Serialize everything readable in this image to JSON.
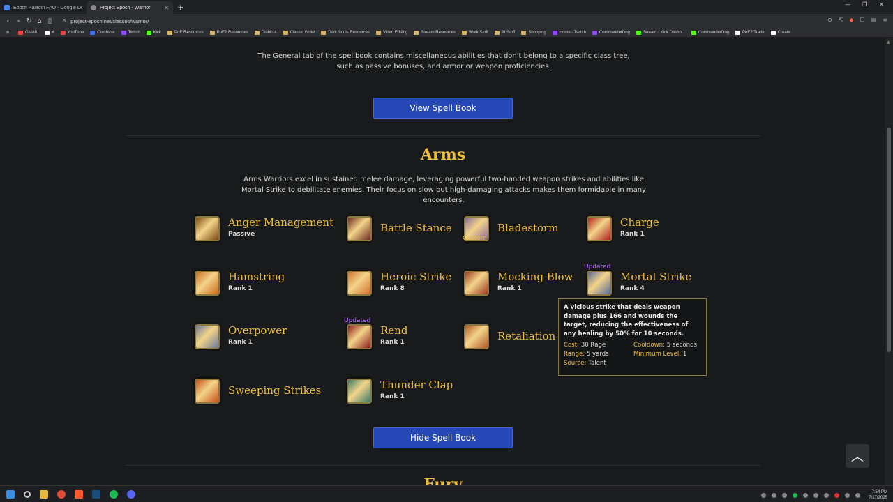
{
  "browser": {
    "tabs": [
      {
        "title": "Epoch Paladin FAQ - Google Docs",
        "active": false,
        "favicon_color": "#4285f4"
      },
      {
        "title": "Project Epoch - Warrior",
        "active": true,
        "favicon_color": "#8a8a8a"
      }
    ],
    "new_tab_icon": "plus-icon",
    "url": "project-epoch.net/classes/warrior/",
    "bookmarks": [
      {
        "label": "GMAIL",
        "icon": "c1"
      },
      {
        "label": "X",
        "icon": "c2"
      },
      {
        "label": "YouTube",
        "icon": "c1"
      },
      {
        "label": "Coinbase",
        "icon": "c5"
      },
      {
        "label": "Twitch",
        "icon": "c3"
      },
      {
        "label": "Kick",
        "icon": "c4"
      },
      {
        "label": "PoE Resources",
        "icon": "folder"
      },
      {
        "label": "PoE2 Resources",
        "icon": "folder"
      },
      {
        "label": "Diablo 4",
        "icon": "folder"
      },
      {
        "label": "Classic WoW",
        "icon": "folder"
      },
      {
        "label": "Dark Souls Resources",
        "icon": "folder"
      },
      {
        "label": "Video Editing",
        "icon": "folder"
      },
      {
        "label": "Stream Resources",
        "icon": "folder"
      },
      {
        "label": "Work Stuff",
        "icon": "folder"
      },
      {
        "label": "AI Stuff",
        "icon": "folder"
      },
      {
        "label": "Shopping",
        "icon": "folder"
      },
      {
        "label": "Home - Twitch",
        "icon": "c3"
      },
      {
        "label": "CommanderDog",
        "icon": "c3"
      },
      {
        "label": "Stream - Kick Dashb...",
        "icon": "c4"
      },
      {
        "label": "CommanderDog",
        "icon": "c4"
      },
      {
        "label": "PoE2 Trade",
        "icon": "c2"
      },
      {
        "label": "Create",
        "icon": "c2"
      }
    ]
  },
  "page": {
    "general_intro": "The General tab of the spellbook contains miscellaneous abilities that don't belong to a specific class tree, such as passive bonuses, and armor or weapon proficiencies.",
    "view_button": "View Spell Book",
    "hide_button": "Hide Spell Book",
    "section_title": "Arms",
    "section_desc": "Arms Warriors excel in sustained melee damage, leveraging powerful two-handed weapon strikes and abilities like Mortal Strike to debilitate enemies. Their focus on slow but high-damaging attacks makes them formidable in many encounters.",
    "next_section_title": "Fury",
    "spells": [
      {
        "name": "Anger Management",
        "rank": "Passive",
        "tag": "",
        "color": "#7a4a12"
      },
      {
        "name": "Battle Stance",
        "rank": "",
        "tag": "",
        "color": "#6b2a20"
      },
      {
        "name": "Bladestorm",
        "rank": "",
        "tag": "Custom",
        "color": "#8a6a9a"
      },
      {
        "name": "Charge",
        "rank": "Rank 1",
        "tag": "",
        "color": "#b0201f"
      },
      {
        "name": "Hamstring",
        "rank": "Rank 1",
        "tag": "",
        "color": "#c96a1c"
      },
      {
        "name": "Heroic Strike",
        "rank": "Rank 8",
        "tag": "",
        "color": "#d0702a"
      },
      {
        "name": "Mocking Blow",
        "rank": "Rank 1",
        "tag": "",
        "color": "#9c3a22"
      },
      {
        "name": "Mortal Strike",
        "rank": "Rank 4",
        "tag": "Updated",
        "color": "#5a6a9a"
      },
      {
        "name": "Overpower",
        "rank": "Rank 1",
        "tag": "",
        "color": "#6a7a9a"
      },
      {
        "name": "Rend",
        "rank": "Rank 1",
        "tag": "Updated",
        "color": "#8a1a1a"
      },
      {
        "name": "Retaliation",
        "rank": "",
        "tag": "",
        "color": "#b05a2a"
      },
      {
        "name": "Sweeping Strikes",
        "rank": "",
        "tag": "",
        "color": "#c8501a"
      },
      {
        "name": "Thunder Clap",
        "rank": "Rank 1",
        "tag": "",
        "color": "#3a7a6a"
      }
    ],
    "tooltip": {
      "description": "A vicious strike that deals weapon damage plus 166 and wounds the target, reducing the effectiveness of any healing by 50% for 10 seconds.",
      "cost_label": "Cost:",
      "cost_value": "30 Rage",
      "cooldown_label": "Cooldown:",
      "cooldown_value": "5 seconds",
      "range_label": "Range:",
      "range_value": "5 yards",
      "min_level_label": "Minimum Level:",
      "min_level_value": "1",
      "source_label": "Source:",
      "source_value": "Talent"
    },
    "back_to_top_icon": "chevron-up-icon"
  },
  "taskbar": {
    "time": "7:54 PM",
    "date": "7/17/2025"
  }
}
